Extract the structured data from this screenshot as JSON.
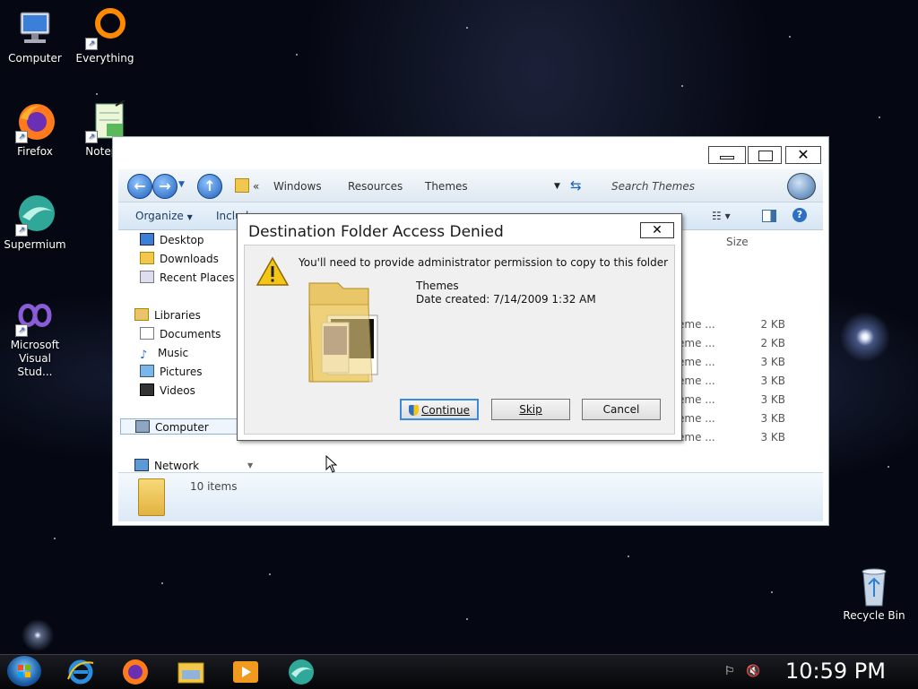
{
  "desktop": {
    "icons": [
      {
        "label": "Computer"
      },
      {
        "label": "Everything"
      },
      {
        "label": "Firefox"
      },
      {
        "label": "Notepa"
      },
      {
        "label": "Supermium"
      },
      {
        "label": "Microsoft Visual Stud..."
      },
      {
        "label": "Recycle Bin"
      }
    ]
  },
  "explorer": {
    "breadcrumbs": [
      "«",
      "Windows",
      "Resources",
      "Themes"
    ],
    "search_placeholder": "Search Themes",
    "toolbar": {
      "organize": "Organize",
      "include": "Includ"
    },
    "nav": {
      "favorites": [
        "Desktop",
        "Downloads",
        "Recent Places"
      ],
      "libraries": "Libraries",
      "library_items": [
        "Documents",
        "Music",
        "Pictures",
        "Videos"
      ],
      "computer": "Computer",
      "network": "Network"
    },
    "columns": {
      "size": "Size"
    },
    "rows": [
      {
        "type": "eme ...",
        "size": "2 KB"
      },
      {
        "type": "eme ...",
        "size": "2 KB"
      },
      {
        "type": "eme ...",
        "size": "3 KB"
      },
      {
        "type": "eme ...",
        "size": "3 KB"
      },
      {
        "type": "eme ...",
        "size": "3 KB"
      },
      {
        "type": "eme ...",
        "size": "3 KB"
      },
      {
        "type": "eme ...",
        "size": "3 KB"
      }
    ],
    "details": {
      "count": "10 items"
    }
  },
  "dialog": {
    "title": "Destination Folder Access Denied",
    "message": "You'll need to provide administrator permission to copy to this folder",
    "folder_name": "Themes",
    "date_created": "Date created: 7/14/2009 1:32 AM",
    "buttons": {
      "continue": "Continue",
      "skip": "Skip",
      "cancel": "Cancel"
    }
  },
  "taskbar": {
    "clock": "10:59 PM"
  },
  "colors": {
    "accent": "#3a8be0",
    "toolbar": "#d6e6f4",
    "warning": "#f5c518"
  }
}
